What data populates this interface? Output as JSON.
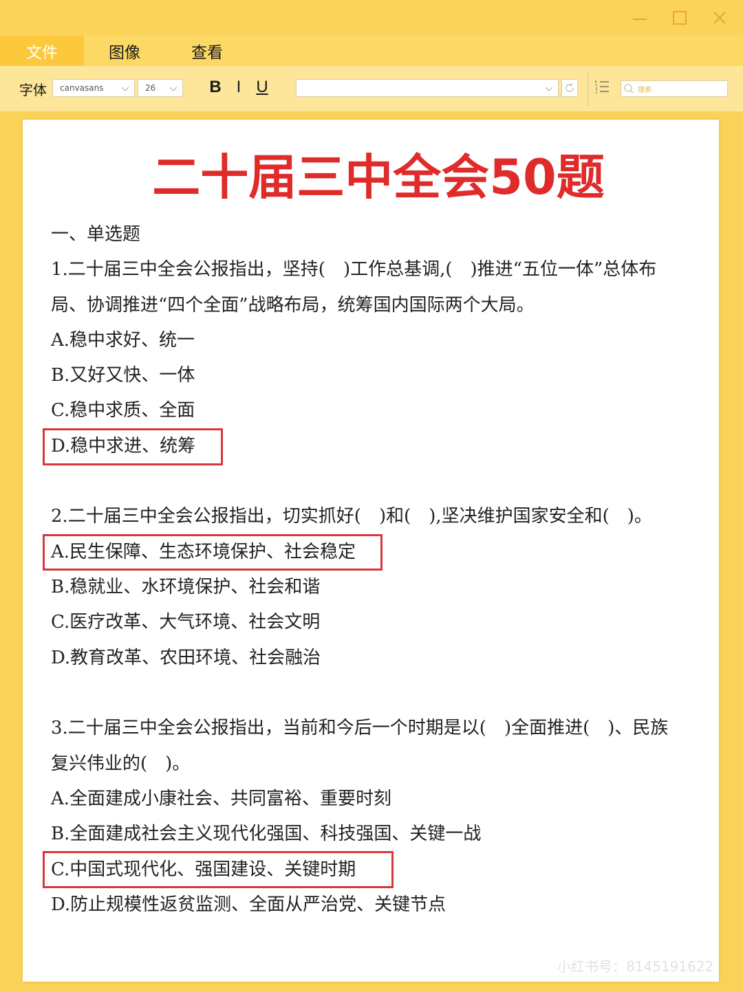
{
  "menubar": {
    "items": [
      {
        "label": "文件"
      },
      {
        "label": "图像"
      },
      {
        "label": "查看"
      }
    ]
  },
  "toolbar": {
    "font_label": "字体",
    "font_value": "canvasans",
    "size_value": "26",
    "bold_label": "B",
    "italic_label": "I",
    "underline_label": "U",
    "search_placeholder": "搜索"
  },
  "document": {
    "title": "二十届三中全会50题",
    "section": "一、单选题",
    "q1": {
      "line1": "1.二十届三中全会公报指出，坚持(　)工作总基调,(　)推进“五位一体”总体布",
      "line2": "局、协调推进“四个全面”战略布局，统筹国内国际两个大局。",
      "a": "A.稳中求好、统一",
      "b": "B.又好又快、一体",
      "c": "C.稳中求质、全面",
      "d": "D.稳中求进、统筹"
    },
    "q2": {
      "line1": "2.二十届三中全会公报指出，切实抓好(　)和(　),坚决维护国家安全和(　)。",
      "a": "A.民生保障、生态环境保护、社会稳定",
      "b": "B.稳就业、水环境保护、社会和谐",
      "c": "C.医疗改革、大气环境、社会文明",
      "d": "D.教育改革、农田环境、社会融治"
    },
    "q3": {
      "line1": "3.二十届三中全会公报指出，当前和今后一个时期是以(　)全面推进(　)、民族",
      "line2": "复兴伟业的(　)。",
      "a": "A.全面建成小康社会、共同富裕、重要时刻",
      "b": "B.全面建成社会主义现代化强国、科技强国、关键一战",
      "c": "C.中国式现代化、强国建设、关键时期",
      "d": "D.防止规模性返贫监测、全面从严治党、关键节点"
    },
    "watermark": "小红书号：8145191622"
  },
  "colors": {
    "title_red": "#e02b2b",
    "answer_box": "#d8363d",
    "background_yellow": "#fbd258",
    "toolbar_yellow": "#fde59a"
  }
}
